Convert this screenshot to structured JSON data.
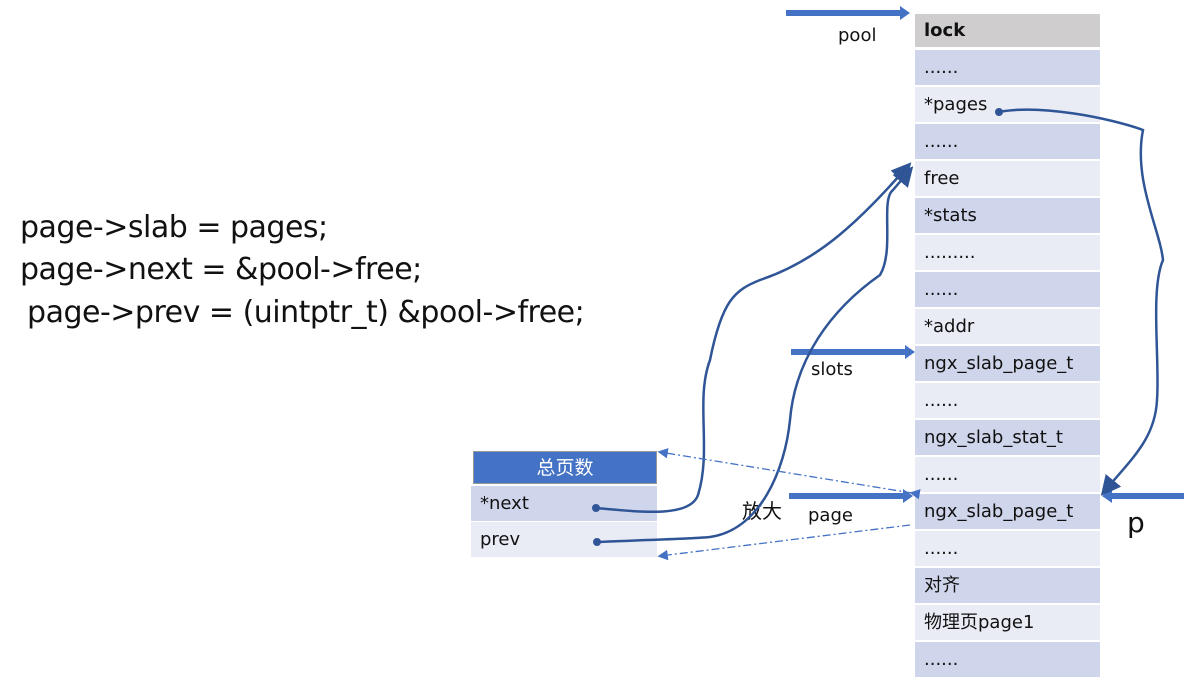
{
  "code_lines": [
    "page->slab = pages;",
    "page->next = &pool->free;",
    " page->prev = (uintptr_t) &pool->free;"
  ],
  "pool_struct": {
    "rows": [
      "lock",
      "......",
      "*pages",
      "......",
      "free",
      "*stats",
      ".........",
      "......",
      "*addr",
      "ngx_slab_page_t",
      "......",
      "ngx_slab_stat_t",
      "......",
      "ngx_slab_page_t",
      "......",
      "对齐",
      "物理页page1",
      "......"
    ]
  },
  "page_struct": {
    "header": "总页数",
    "rows": [
      "*next",
      "prev"
    ]
  },
  "labels": {
    "pool": "pool",
    "slots": "slots",
    "page": "page",
    "zoom": "放大",
    "p": "p"
  },
  "colors": {
    "arrow": "#4472c4",
    "line": "#2f5597",
    "header": "#4472c4",
    "row_dark": "#cfd5ea",
    "row_light": "#e9ebf5",
    "lock": "#cfcdcd"
  }
}
